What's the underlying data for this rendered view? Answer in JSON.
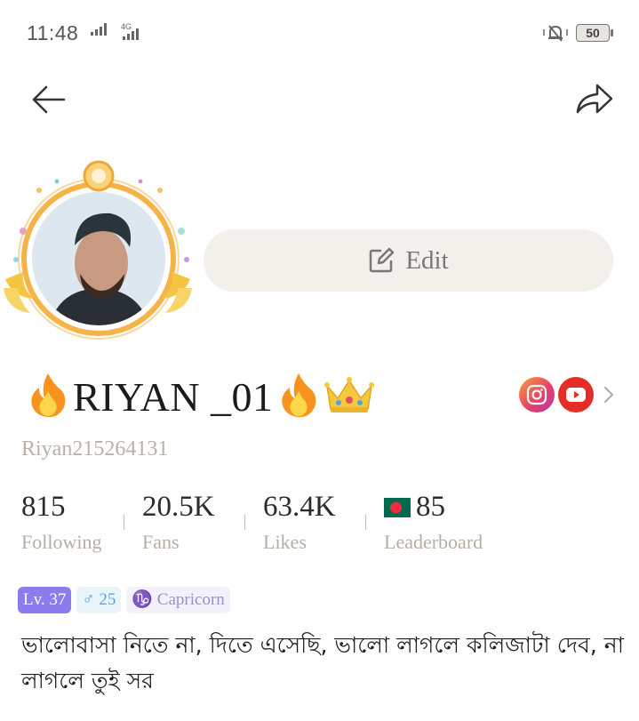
{
  "status_bar": {
    "time": "11:48",
    "network": "4G",
    "battery": "50"
  },
  "nav": {
    "back_icon": "arrow-left-icon",
    "share_icon": "share-arrow-icon"
  },
  "profile": {
    "edit_label": "Edit",
    "name": "RIYAN _01",
    "name_prefix_emoji": "🔥",
    "name_suffix_emoji": "🔥",
    "crown_emoji": "👑",
    "user_id": "Riyan215264131",
    "stats": [
      {
        "value": "815",
        "label": "Following"
      },
      {
        "value": "20.5K",
        "label": "Fans"
      },
      {
        "value": "63.4K",
        "label": "Likes"
      },
      {
        "value": "85",
        "label": "Leaderboard"
      }
    ],
    "tags": {
      "level": "Lv. 37",
      "gender_symbol": "♂",
      "age": "25",
      "zodiac_symbol": "♑",
      "zodiac": "Capricorn"
    },
    "bio": "ভালোবাসা নিতে না, দিতে এসেছি, ভালো লাগলে কলিজাটা দেব, না লাগলে তুই সর"
  },
  "colors": {
    "edit_bg": "#f3efea",
    "level_tag": "#8b7cf0",
    "muted_text": "#b6ada3",
    "flag_green": "#006a4e",
    "flag_red": "#f42a41"
  }
}
